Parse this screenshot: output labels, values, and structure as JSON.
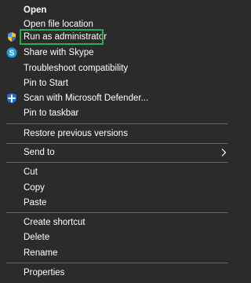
{
  "context_menu": {
    "items": [
      {
        "label": "Open"
      },
      {
        "label": "Open file location"
      },
      {
        "label": "Run as administrator",
        "icon": "uac-shield-icon"
      },
      {
        "label": "Share with Skype",
        "icon": "skype-icon"
      },
      {
        "label": "Troubleshoot compatibility"
      },
      {
        "label": "Pin to Start"
      },
      {
        "label": "Scan with Microsoft Defender...",
        "icon": "defender-shield-icon"
      },
      {
        "label": "Pin to taskbar"
      },
      {
        "label": "Restore previous versions"
      },
      {
        "label": "Send to",
        "icon": "chevron-right-icon"
      },
      {
        "label": "Cut"
      },
      {
        "label": "Copy"
      },
      {
        "label": "Paste"
      },
      {
        "label": "Create shortcut"
      },
      {
        "label": "Delete"
      },
      {
        "label": "Rename"
      },
      {
        "label": "Properties"
      }
    ],
    "highlighted_item": "Run as administrator",
    "colors": {
      "background": "#2b2b2b",
      "text": "#ffffff",
      "separator": "#6a6a6a",
      "highlight_border": "#27b04a",
      "skype_blue": "#1e9bdc",
      "defender_blue": "#1f6fd1"
    }
  }
}
